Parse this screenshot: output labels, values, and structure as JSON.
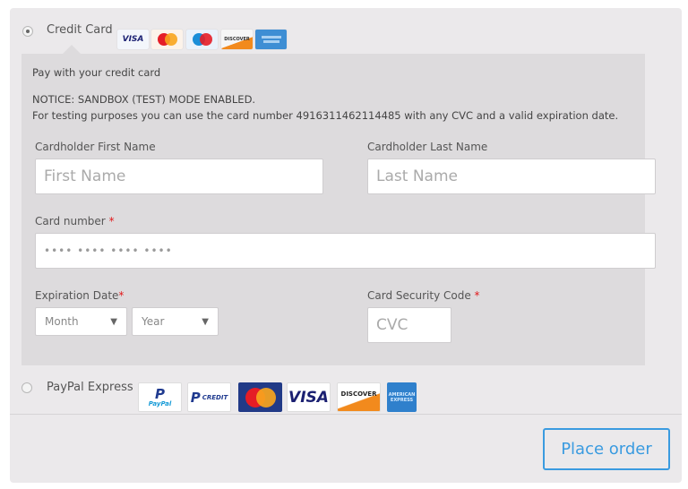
{
  "payment_methods": {
    "credit_card": {
      "label": "Credit Card",
      "selected": true,
      "logos": [
        "visa-logo",
        "mastercard-logo",
        "maestro-logo",
        "discover-logo",
        "amex-logo"
      ],
      "logo_text": {
        "visa": "VISA",
        "discover": "DISCOVER"
      }
    },
    "paypal_express": {
      "label": "PayPal Express",
      "selected": false,
      "logos": [
        "paypal-logo",
        "paypal-credit-logo",
        "mastercard-logo",
        "visa-logo",
        "discover-logo",
        "amex-logo"
      ],
      "logo_text": {
        "paypal": "PayPal",
        "paypal_credit": "CREDIT",
        "mastercard": "MasterCard",
        "visa": "VISA",
        "discover": "DISCOVER",
        "amex": "AMERICAN EXPRESS"
      }
    }
  },
  "credit_card_form": {
    "intro": "Pay with your credit card",
    "notice_line1": "NOTICE: SANDBOX (TEST) MODE ENABLED.",
    "notice_line2": "For testing purposes you can use the card number 4916311462114485 with any CVC and a valid expiration date.",
    "first_name": {
      "label": "Cardholder First Name",
      "placeholder": "First Name",
      "value": ""
    },
    "last_name": {
      "label": "Cardholder Last Name",
      "placeholder": "Last Name",
      "value": ""
    },
    "card_number": {
      "label": "Card number",
      "required_mark": "*",
      "placeholder": "•••• •••• •••• ••••",
      "value": ""
    },
    "expiration": {
      "label": "Expiration Date",
      "required_mark": "*",
      "month": {
        "selected": "Month"
      },
      "year": {
        "selected": "Year"
      }
    },
    "cvc": {
      "label": "Card Security Code",
      "required_mark": "*",
      "placeholder": "CVC",
      "value": ""
    }
  },
  "actions": {
    "place_order_label": "Place order"
  },
  "colors": {
    "accent": "#3a9be0",
    "required": "#e2191b",
    "panel_bg": "#ebe9eb",
    "form_bg": "#dddbdd"
  }
}
